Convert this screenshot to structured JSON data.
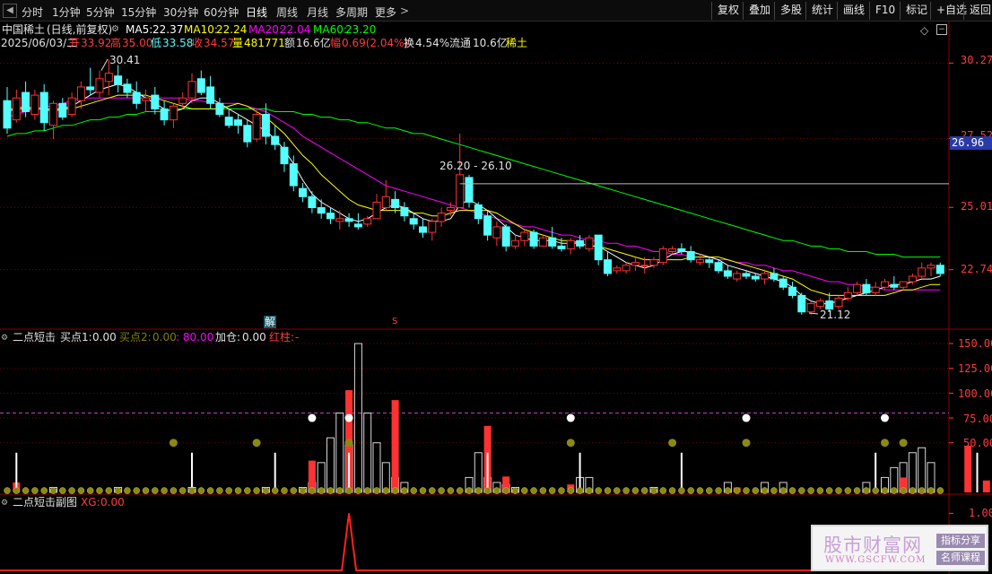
{
  "toolbar": {
    "periods": [
      "分时",
      "1分钟",
      "5分钟",
      "15分钟",
      "30分钟",
      "60分钟",
      "日线",
      "周线",
      "月线",
      "多周期",
      "更多"
    ],
    "right_buttons": [
      "复权",
      "叠加",
      "多股",
      "统计",
      "画线",
      "F10",
      "标记",
      "+自选",
      "返回"
    ]
  },
  "stock": {
    "name": "中国稀土",
    "chart_mode": "(日线,前复权)",
    "date": "2025/06/03/二",
    "open_label": "开",
    "open": "33.92",
    "high_label": "高",
    "high": "35.00",
    "low_label": "低",
    "low": "33.58",
    "close_label": "收",
    "close": "34.57",
    "volume_label": "量",
    "volume": "481771",
    "amount_label": "额",
    "amount": "16.6亿",
    "change_label": "幅",
    "change": "0.69(2.04%)",
    "turnover_label": "换",
    "turnover": "4.54%",
    "float_label": "流通",
    "float": "10.6亿",
    "sector": "稀土"
  },
  "ma": {
    "ma5_label": "MA5:",
    "ma5": "22.37",
    "ma10_label": "MA10:",
    "ma10": "22.24",
    "ma20_label": "MA20:",
    "ma20": "22.04",
    "ma60_label": "MA60:",
    "ma60": "23.20"
  },
  "price_axis": [
    "30.27",
    "27.52",
    "25.01",
    "22.74"
  ],
  "price_marker": "26.96",
  "annotations": {
    "high_point": "30.41",
    "low_point": "21.12",
    "range_line": "26.20 - 26.10",
    "event_marker_1": "解",
    "event_marker_2": "S"
  },
  "indicator1": {
    "title": "二点短击",
    "buy1_label": "买点1:",
    "buy1": "0.00",
    "buy2_label": "买点2:",
    "buy2": "0.00",
    "buy2_extra": ": 80.00",
    "add_label": "加仓:",
    "add": "0.00",
    "red_label": "红柱:",
    "red": "-",
    "axis": [
      "150.00",
      "125.00",
      "100.00",
      "75.00",
      "50.00"
    ]
  },
  "indicator2": {
    "title": "二点短击副图",
    "xg_label": "XG:",
    "xg": "0.00",
    "axis": [
      "1.00"
    ]
  },
  "watermark": {
    "title": "股市财富网",
    "url": "WWW.GSCFW.COM",
    "tag1": "指标分享",
    "tag2": "名师课程"
  },
  "colors": {
    "up": "#ff3232",
    "down": "#54ffff",
    "ma5": "#ffffff",
    "ma10": "#ffff00",
    "ma20": "#ff00ff",
    "ma60": "#00ff00",
    "grid": "#7a0000",
    "axis_text": "#ff3c3c"
  },
  "chart_data": {
    "type": "candlestick",
    "candles_ohlc": [
      [
        28.9,
        29.4,
        27.7,
        27.9
      ],
      [
        28.2,
        29.3,
        28.1,
        29.0
      ],
      [
        29.2,
        29.6,
        28.3,
        28.5
      ],
      [
        28.4,
        29.3,
        28.2,
        29.1
      ],
      [
        29.2,
        29.5,
        27.8,
        28.1
      ],
      [
        28.0,
        28.9,
        27.5,
        28.8
      ],
      [
        28.8,
        29.0,
        28.2,
        28.3
      ],
      [
        28.4,
        29.2,
        28.3,
        29.0
      ],
      [
        28.9,
        29.6,
        28.6,
        29.4
      ],
      [
        29.4,
        30.1,
        29.1,
        29.3
      ],
      [
        29.2,
        30.0,
        29.0,
        29.7
      ],
      [
        29.6,
        30.4,
        29.1,
        29.9
      ],
      [
        29.8,
        30.2,
        29.2,
        29.5
      ],
      [
        29.5,
        29.7,
        29.0,
        29.2
      ],
      [
        29.2,
        29.6,
        28.6,
        28.8
      ],
      [
        28.9,
        29.3,
        28.5,
        29.0
      ],
      [
        29.1,
        29.4,
        28.4,
        28.6
      ],
      [
        28.6,
        28.9,
        28.0,
        28.2
      ],
      [
        28.2,
        28.8,
        27.9,
        28.7
      ],
      [
        28.8,
        29.2,
        28.6,
        29.0
      ],
      [
        29.0,
        29.9,
        28.8,
        29.6
      ],
      [
        29.7,
        30.0,
        29.1,
        29.2
      ],
      [
        29.4,
        29.8,
        28.6,
        28.8
      ],
      [
        28.8,
        29.0,
        28.3,
        28.4
      ],
      [
        28.3,
        28.6,
        27.9,
        28.0
      ],
      [
        28.2,
        28.4,
        27.7,
        28.0
      ],
      [
        28.0,
        28.2,
        27.2,
        27.4
      ],
      [
        27.5,
        28.6,
        27.4,
        28.4
      ],
      [
        28.4,
        28.8,
        27.3,
        27.6
      ],
      [
        27.6,
        28.0,
        27.1,
        27.3
      ],
      [
        27.2,
        27.4,
        26.3,
        26.6
      ],
      [
        26.6,
        26.9,
        25.6,
        25.8
      ],
      [
        25.7,
        25.9,
        25.2,
        25.4
      ],
      [
        25.4,
        25.6,
        24.8,
        25.0
      ],
      [
        25.0,
        25.3,
        24.6,
        24.8
      ],
      [
        24.8,
        25.0,
        24.4,
        24.6
      ],
      [
        24.5,
        24.9,
        24.2,
        24.6
      ],
      [
        24.6,
        24.8,
        24.3,
        24.5
      ],
      [
        24.4,
        24.8,
        24.2,
        24.3
      ],
      [
        24.4,
        24.7,
        24.3,
        24.6
      ],
      [
        24.6,
        25.5,
        24.6,
        25.2
      ],
      [
        25.0,
        26.0,
        24.9,
        25.4
      ],
      [
        25.3,
        25.6,
        24.8,
        25.0
      ],
      [
        25.0,
        25.2,
        24.5,
        24.7
      ],
      [
        24.6,
        24.8,
        24.2,
        24.4
      ],
      [
        24.3,
        24.6,
        23.9,
        24.1
      ],
      [
        24.1,
        24.6,
        23.8,
        24.5
      ],
      [
        24.5,
        25.0,
        24.3,
        24.8
      ],
      [
        24.9,
        25.2,
        24.7,
        25.0
      ],
      [
        25.0,
        27.7,
        25.0,
        26.2
      ],
      [
        26.1,
        26.2,
        25.0,
        25.2
      ],
      [
        25.1,
        25.2,
        24.4,
        24.6
      ],
      [
        24.7,
        24.9,
        23.8,
        24.0
      ],
      [
        23.9,
        24.5,
        23.6,
        24.3
      ],
      [
        24.3,
        24.4,
        23.4,
        23.6
      ],
      [
        23.6,
        24.0,
        23.5,
        23.8
      ],
      [
        23.8,
        24.2,
        23.6,
        24.1
      ],
      [
        24.1,
        24.2,
        23.5,
        23.6
      ],
      [
        23.6,
        24.0,
        23.6,
        23.9
      ],
      [
        23.9,
        24.3,
        23.5,
        23.6
      ],
      [
        23.6,
        23.9,
        23.4,
        23.5
      ],
      [
        23.5,
        23.9,
        23.3,
        23.8
      ],
      [
        23.8,
        24.0,
        23.5,
        23.6
      ],
      [
        23.5,
        24.0,
        23.4,
        23.9
      ],
      [
        24.0,
        24.0,
        22.9,
        23.1
      ],
      [
        23.1,
        23.4,
        22.5,
        22.6
      ],
      [
        22.7,
        22.9,
        22.6,
        22.8
      ],
      [
        22.7,
        23.0,
        22.6,
        22.9
      ],
      [
        22.9,
        23.2,
        22.7,
        23.0
      ],
      [
        22.9,
        23.2,
        22.6,
        22.9
      ],
      [
        22.9,
        23.2,
        22.8,
        23.1
      ],
      [
        23.0,
        23.6,
        22.9,
        23.5
      ],
      [
        23.4,
        23.6,
        23.3,
        23.5
      ],
      [
        23.5,
        23.7,
        23.3,
        23.4
      ],
      [
        23.4,
        23.6,
        23.0,
        23.1
      ],
      [
        23.0,
        23.3,
        22.9,
        23.1
      ],
      [
        23.1,
        23.2,
        22.8,
        23.0
      ],
      [
        23.0,
        23.1,
        22.6,
        22.7
      ],
      [
        22.7,
        22.9,
        22.4,
        22.5
      ],
      [
        22.4,
        22.7,
        22.3,
        22.6
      ],
      [
        22.6,
        22.7,
        22.4,
        22.5
      ],
      [
        22.5,
        22.6,
        22.3,
        22.4
      ],
      [
        22.4,
        22.7,
        22.2,
        22.6
      ],
      [
        22.6,
        22.8,
        22.3,
        22.4
      ],
      [
        22.4,
        22.5,
        22.0,
        22.1
      ],
      [
        22.1,
        22.3,
        21.7,
        21.8
      ],
      [
        21.8,
        21.9,
        21.1,
        21.2
      ],
      [
        21.2,
        21.6,
        21.1,
        21.5
      ],
      [
        21.4,
        21.7,
        21.3,
        21.6
      ],
      [
        21.6,
        21.9,
        21.2,
        21.3
      ],
      [
        21.4,
        21.8,
        21.3,
        21.7
      ],
      [
        21.7,
        22.1,
        21.6,
        21.9
      ],
      [
        21.9,
        22.3,
        21.8,
        22.2
      ],
      [
        22.2,
        22.4,
        21.8,
        21.9
      ],
      [
        21.9,
        22.3,
        21.8,
        22.1
      ],
      [
        22.1,
        22.4,
        22.0,
        22.3
      ],
      [
        22.2,
        22.5,
        22.0,
        22.1
      ],
      [
        22.1,
        22.3,
        22.0,
        22.3
      ],
      [
        22.3,
        22.6,
        22.2,
        22.5
      ],
      [
        22.5,
        23.0,
        22.4,
        22.8
      ],
      [
        22.8,
        23.0,
        22.5,
        22.9
      ],
      [
        22.9,
        23.0,
        22.5,
        22.6
      ]
    ],
    "ma5": [
      28.5,
      28.6,
      28.7,
      28.6,
      28.6,
      28.5,
      28.6,
      28.7,
      28.9,
      29.1,
      29.3,
      29.4,
      29.5,
      29.4,
      29.2,
      29.0,
      28.8,
      28.6,
      28.5,
      28.6,
      28.9,
      29.0,
      29.0,
      28.8,
      28.6,
      28.4,
      28.2,
      28.0,
      27.8,
      27.5,
      27.1,
      26.6,
      26.0,
      25.5,
      25.2,
      25.0,
      24.8,
      24.6,
      24.5,
      24.6,
      24.8,
      25.0,
      25.1,
      25.0,
      24.8,
      24.6,
      24.5,
      24.5,
      24.6,
      25.1,
      25.3,
      25.1,
      24.9,
      24.6,
      24.3,
      24.0,
      23.9,
      23.8,
      23.8,
      23.8,
      23.7,
      23.7,
      23.7,
      23.6,
      23.6,
      23.4,
      23.2,
      23.0,
      22.9,
      22.8,
      22.9,
      23.1,
      23.3,
      23.4,
      23.4,
      23.3,
      23.2,
      23.1,
      22.9,
      22.8,
      22.7,
      22.6,
      22.5,
      22.4,
      22.3,
      22.1,
      21.8,
      21.6,
      21.5,
      21.5,
      21.6,
      21.7,
      21.8,
      21.9,
      22.0,
      22.1,
      22.2,
      22.2,
      22.3,
      22.4,
      22.4,
      22.5
    ],
    "ma10": [
      28.6,
      28.6,
      28.6,
      28.6,
      28.6,
      28.6,
      28.6,
      28.6,
      28.7,
      28.8,
      28.9,
      29.0,
      29.1,
      29.1,
      29.1,
      29.1,
      29.0,
      28.9,
      28.8,
      28.7,
      28.6,
      28.6,
      28.6,
      28.6,
      28.7,
      28.8,
      28.7,
      28.5,
      28.3,
      28.0,
      27.7,
      27.3,
      26.9,
      26.6,
      26.2,
      25.9,
      25.6,
      25.3,
      25.1,
      25.0,
      24.9,
      24.9,
      24.9,
      24.9,
      24.8,
      24.8,
      24.7,
      24.7,
      24.8,
      24.9,
      24.9,
      24.9,
      24.9,
      24.8,
      24.6,
      24.4,
      24.2,
      24.1,
      24.0,
      23.9,
      23.8,
      23.8,
      23.7,
      23.6,
      23.6,
      23.5,
      23.4,
      23.3,
      23.2,
      23.1,
      23.1,
      23.1,
      23.1,
      23.1,
      23.2,
      23.2,
      23.2,
      23.2,
      23.1,
      23.0,
      22.9,
      22.8,
      22.7,
      22.6,
      22.5,
      22.4,
      22.2,
      22.0,
      21.9,
      21.8,
      21.8,
      21.8,
      21.8,
      21.8,
      21.8,
      21.8,
      21.9,
      22.0,
      22.0,
      22.1,
      22.2,
      22.2
    ],
    "ma20": [
      28.3,
      28.4,
      28.5,
      28.6,
      28.7,
      28.7,
      28.8,
      28.9,
      29.0,
      29.0,
      29.0,
      29.0,
      29.0,
      29.0,
      29.0,
      29.0,
      29.0,
      29.0,
      29.0,
      29.0,
      28.9,
      28.9,
      28.8,
      28.8,
      28.8,
      28.8,
      28.7,
      28.6,
      28.5,
      28.3,
      28.1,
      27.9,
      27.6,
      27.4,
      27.2,
      27.0,
      26.8,
      26.6,
      26.4,
      26.2,
      26.0,
      25.8,
      25.7,
      25.6,
      25.5,
      25.4,
      25.3,
      25.2,
      25.1,
      25.0,
      24.9,
      24.8,
      24.7,
      24.6,
      24.5,
      24.4,
      24.3,
      24.3,
      24.2,
      24.1,
      24.0,
      24.0,
      23.9,
      23.8,
      23.8,
      23.7,
      23.7,
      23.6,
      23.6,
      23.5,
      23.4,
      23.4,
      23.3,
      23.3,
      23.2,
      23.2,
      23.2,
      23.1,
      23.1,
      23.0,
      23.0,
      22.9,
      22.9,
      22.8,
      22.7,
      22.7,
      22.6,
      22.5,
      22.4,
      22.3,
      22.3,
      22.2,
      22.2,
      22.1,
      22.1,
      22.0,
      22.0,
      22.0,
      22.0,
      22.0,
      22.0,
      22.0
    ],
    "ma60": [
      27.6,
      27.7,
      27.7,
      27.8,
      27.8,
      27.9,
      28.0,
      28.0,
      28.1,
      28.2,
      28.2,
      28.3,
      28.3,
      28.4,
      28.4,
      28.5,
      28.5,
      28.5,
      28.6,
      28.6,
      28.6,
      28.6,
      28.6,
      28.6,
      28.6,
      28.6,
      28.6,
      28.6,
      28.6,
      28.5,
      28.5,
      28.5,
      28.4,
      28.4,
      28.3,
      28.3,
      28.2,
      28.2,
      28.1,
      28.1,
      28.0,
      27.9,
      27.9,
      27.8,
      27.7,
      27.7,
      27.6,
      27.5,
      27.4,
      27.3,
      27.2,
      27.1,
      27.0,
      26.9,
      26.8,
      26.7,
      26.6,
      26.5,
      26.4,
      26.3,
      26.2,
      26.1,
      26.0,
      25.9,
      25.8,
      25.7,
      25.6,
      25.5,
      25.4,
      25.3,
      25.2,
      25.1,
      25.0,
      24.9,
      24.8,
      24.7,
      24.6,
      24.5,
      24.4,
      24.3,
      24.2,
      24.1,
      24.0,
      23.9,
      23.8,
      23.8,
      23.7,
      23.6,
      23.6,
      23.5,
      23.5,
      23.4,
      23.4,
      23.4,
      23.3,
      23.3,
      23.3,
      23.2,
      23.2,
      23.2,
      23.2,
      23.2
    ],
    "indicator1": {
      "hollow_bars": [
        {
          "i": 5,
          "v": 5
        },
        {
          "i": 12,
          "v": 5
        },
        {
          "i": 20,
          "v": 5
        },
        {
          "i": 28,
          "v": 5
        },
        {
          "i": 32,
          "v": 5
        },
        {
          "i": 33,
          "v": 10
        },
        {
          "i": 34,
          "v": 30
        },
        {
          "i": 35,
          "v": 55
        },
        {
          "i": 36,
          "v": 80
        },
        {
          "i": 37,
          "v": 48
        },
        {
          "i": 38,
          "v": 150
        },
        {
          "i": 39,
          "v": 80
        },
        {
          "i": 40,
          "v": 50
        },
        {
          "i": 41,
          "v": 30
        },
        {
          "i": 42,
          "v": 15
        },
        {
          "i": 43,
          "v": 10
        },
        {
          "i": 50,
          "v": 15
        },
        {
          "i": 51,
          "v": 40
        },
        {
          "i": 52,
          "v": 15
        },
        {
          "i": 53,
          "v": 10
        },
        {
          "i": 54,
          "v": 8
        },
        {
          "i": 55,
          "v": 5
        },
        {
          "i": 62,
          "v": 15
        },
        {
          "i": 63,
          "v": 15
        },
        {
          "i": 70,
          "v": 5
        },
        {
          "i": 78,
          "v": 10
        },
        {
          "i": 82,
          "v": 10
        },
        {
          "i": 84,
          "v": 10
        },
        {
          "i": 93,
          "v": 10
        },
        {
          "i": 95,
          "v": 15
        },
        {
          "i": 96,
          "v": 25
        },
        {
          "i": 97,
          "v": 30
        },
        {
          "i": 98,
          "v": 40
        },
        {
          "i": 99,
          "v": 45
        },
        {
          "i": 100,
          "v": 30
        }
      ],
      "red_bars": [
        {
          "i": 1,
          "v": 10
        },
        {
          "i": 33,
          "v": 32
        },
        {
          "i": 37,
          "v": 103
        },
        {
          "i": 42,
          "v": 93
        },
        {
          "i": 52,
          "v": 67
        },
        {
          "i": 54,
          "v": 16
        },
        {
          "i": 61,
          "v": 8
        },
        {
          "i": 79,
          "v": 5
        },
        {
          "i": 97,
          "v": 15
        },
        {
          "i": 104,
          "v": 47
        },
        {
          "i": 106,
          "v": 12
        }
      ],
      "white_spikes": [
        {
          "i": 1,
          "v": 40
        },
        {
          "i": 20,
          "v": 40
        },
        {
          "i": 29,
          "v": 40
        },
        {
          "i": 37,
          "v": 40
        },
        {
          "i": 52,
          "v": 40
        },
        {
          "i": 62,
          "v": 40
        },
        {
          "i": 73,
          "v": 40
        },
        {
          "i": 94,
          "v": 40
        },
        {
          "i": 105,
          "v": 40
        }
      ],
      "white_dots": [
        {
          "i": 33,
          "v": 75
        },
        {
          "i": 37,
          "v": 75
        },
        {
          "i": 61,
          "v": 75
        },
        {
          "i": 80,
          "v": 75
        },
        {
          "i": 95,
          "v": 75
        }
      ],
      "olive_dots": [
        {
          "i": 18,
          "v": 50
        },
        {
          "i": 27,
          "v": 50
        },
        {
          "i": 37,
          "v": 50
        },
        {
          "i": 61,
          "v": 50
        },
        {
          "i": 72,
          "v": 50
        },
        {
          "i": 80,
          "v": 50
        },
        {
          "i": 95,
          "v": 50
        },
        {
          "i": 97,
          "v": 50
        }
      ],
      "threshold": 80,
      "ylim": [
        0,
        160
      ]
    },
    "indicator2": {
      "spike_index": 37,
      "spike_value": 1.0,
      "ylim": [
        0,
        1.1
      ]
    },
    "price_ylim": [
      20.8,
      31.0
    ]
  }
}
